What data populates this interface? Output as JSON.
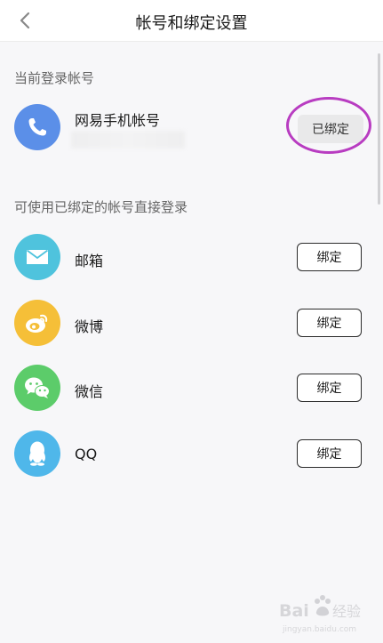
{
  "header": {
    "title": "帐号和绑定设置",
    "back_icon": "chevron-left-icon"
  },
  "current_section": {
    "label": "当前登录帐号",
    "account": {
      "name": "网易手机帐号",
      "icon": "phone-icon",
      "color": "#5b8fe8",
      "button_label": "已绑定"
    }
  },
  "linked_section": {
    "label": "可使用已绑定的帐号直接登录",
    "items": [
      {
        "name": "邮箱",
        "icon": "mail-icon",
        "color": "#4fc3dd",
        "button_label": "绑定"
      },
      {
        "name": "微博",
        "icon": "weibo-icon",
        "color": "#f5bf38",
        "button_label": "绑定"
      },
      {
        "name": "微信",
        "icon": "wechat-icon",
        "color": "#5ccc6a",
        "button_label": "绑定"
      },
      {
        "name": "QQ",
        "icon": "qq-icon",
        "color": "#4fb7ea",
        "button_label": "绑定"
      }
    ]
  },
  "annotation": {
    "highlight_color": "#b83cc1"
  },
  "watermark": {
    "text": "Baidu 经验",
    "subtext": "jingyan.baidu.com"
  }
}
